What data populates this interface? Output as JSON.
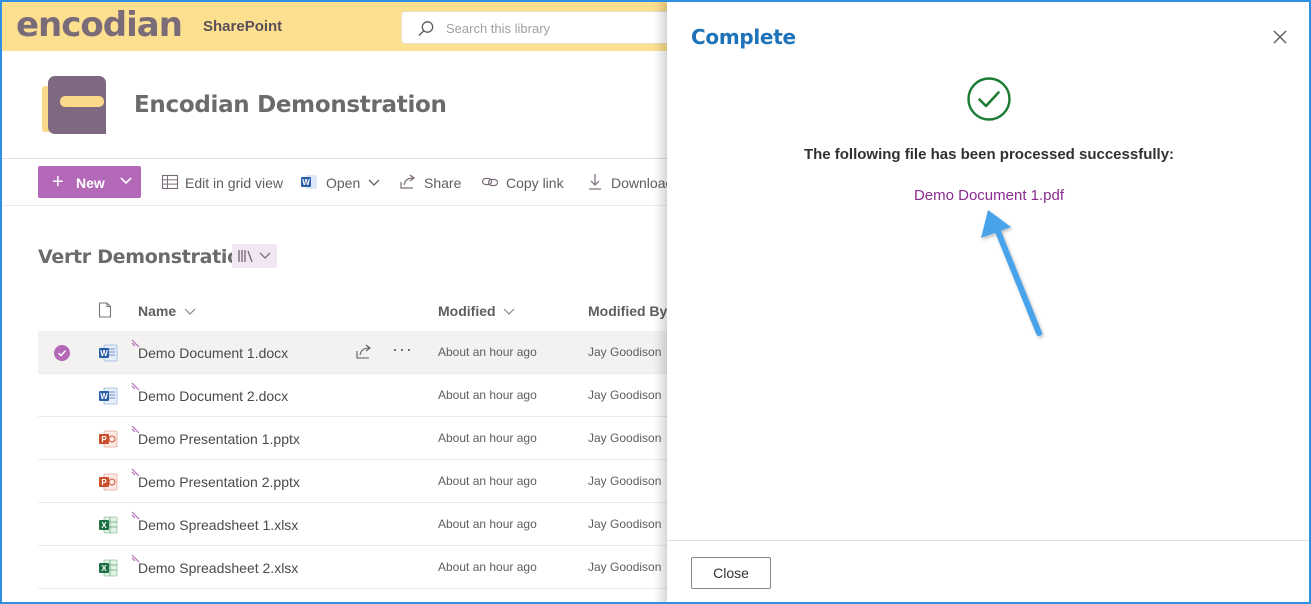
{
  "topbar": {
    "logo": "encodian",
    "app_title": "SharePoint",
    "search_placeholder": "Search this library"
  },
  "site": {
    "title": "Encodian Demonstration"
  },
  "commandbar": {
    "new_label": "New",
    "edit_grid": "Edit in grid view",
    "open": "Open",
    "share": "Share",
    "copy_link": "Copy link",
    "download": "Download"
  },
  "library": {
    "title": "Vertr Demonstration",
    "columns": {
      "name": "Name",
      "modified": "Modified",
      "modified_by": "Modified By"
    },
    "rows": [
      {
        "name": "Demo Document 1.docx",
        "modified": "About an hour ago",
        "modified_by": "Jay Goodison",
        "type": "word"
      },
      {
        "name": "Demo Document 2.docx",
        "modified": "About an hour ago",
        "modified_by": "Jay Goodison",
        "type": "word"
      },
      {
        "name": "Demo Presentation 1.pptx",
        "modified": "About an hour ago",
        "modified_by": "Jay Goodison",
        "type": "powerpoint"
      },
      {
        "name": "Demo Presentation 2.pptx",
        "modified": "About an hour ago",
        "modified_by": "Jay Goodison",
        "type": "powerpoint"
      },
      {
        "name": "Demo Spreadsheet 1.xlsx",
        "modified": "About an hour ago",
        "modified_by": "Jay Goodison",
        "type": "excel"
      },
      {
        "name": "Demo Spreadsheet 2.xlsx",
        "modified": "About an hour ago",
        "modified_by": "Jay Goodison",
        "type": "excel"
      }
    ]
  },
  "panel": {
    "title": "Complete",
    "message": "The following file has been processed successfully:",
    "file_link": "Demo Document 1.pdf",
    "close_button": "Close"
  },
  "colors": {
    "brand_yellow": "#fde08f",
    "accent_purple": "#b468b8",
    "link_purple": "#8a2b8f",
    "title_blue": "#1d72b8",
    "success_green": "#1e7b34",
    "annotation_blue": "#4aa3ea"
  }
}
